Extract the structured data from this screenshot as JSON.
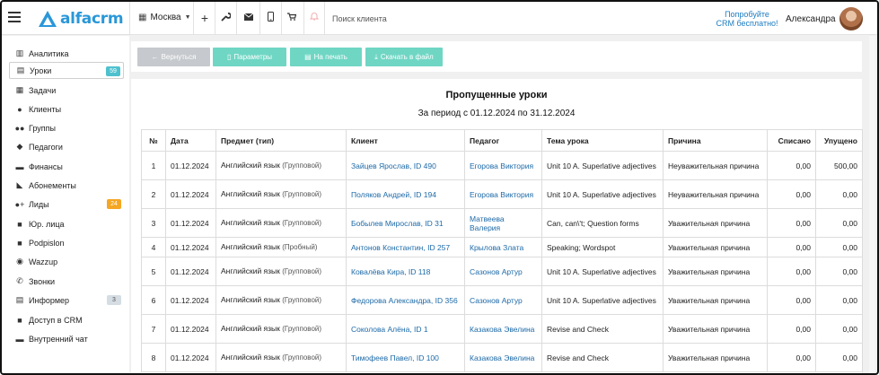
{
  "header": {
    "logo_text": "alfacrm",
    "branch": "Москва",
    "search_placeholder": "Поиск клиента",
    "promo_line1": "Попробуйте",
    "promo_line2": "CRM бесплатно!",
    "user_name": "Александра"
  },
  "sidebar": {
    "items": [
      {
        "label": "Аналитика",
        "icon": "chart-icon",
        "glyph": "▥"
      },
      {
        "label": "Уроки",
        "icon": "calendar-icon",
        "glyph": "▤",
        "badge": "59",
        "badge_color": "#4fc1ce",
        "active": true
      },
      {
        "label": "Задачи",
        "icon": "clipboard-icon",
        "glyph": "▦"
      },
      {
        "label": "Клиенты",
        "icon": "user-icon",
        "glyph": "●"
      },
      {
        "label": "Группы",
        "icon": "users-icon",
        "glyph": "●●"
      },
      {
        "label": "Педагоги",
        "icon": "graduation-cap-icon",
        "glyph": "◆"
      },
      {
        "label": "Финансы",
        "icon": "money-icon",
        "glyph": "▬"
      },
      {
        "label": "Абонементы",
        "icon": "tag-icon",
        "glyph": "◣"
      },
      {
        "label": "Лиды",
        "icon": "user-plus-icon",
        "glyph": "●+",
        "badge": "24",
        "badge_color": "#f5a623"
      },
      {
        "label": "Юр. лица",
        "icon": "truck-icon",
        "glyph": "■"
      },
      {
        "label": "Podpislon",
        "icon": "podpislon-icon",
        "glyph": "■"
      },
      {
        "label": "Wazzup",
        "icon": "whatsapp-icon",
        "glyph": "◉"
      },
      {
        "label": "Звонки",
        "icon": "phone-icon",
        "glyph": "✆"
      },
      {
        "label": "Информер",
        "icon": "newspaper-icon",
        "glyph": "▤",
        "badge": "3",
        "badge_color": "#d5dde3",
        "badge_text_color": "#555"
      },
      {
        "label": "Доступ в CRM",
        "icon": "lock-icon",
        "glyph": "■"
      },
      {
        "label": "Внутренний чат",
        "icon": "chat-icon",
        "glyph": "▬"
      }
    ]
  },
  "toolbar": {
    "back_label": "Вернуться",
    "params_label": "Параметры",
    "print_label": "На печать",
    "download_label": "Скачать в файл",
    "back_color": "#c6c9cd",
    "action_color": "#6fd6c4"
  },
  "report": {
    "title": "Пропущенные уроки",
    "subtitle": "За период с 01.12.2024 по 31.12.2024",
    "columns": [
      "№",
      "Дата",
      "Предмет (тип)",
      "Клиент",
      "Педагог",
      "Тема урока",
      "Причина",
      "Списано",
      "Упущено"
    ],
    "rows": [
      {
        "n": "1",
        "date": "01.12.2024",
        "subject": "Английский язык",
        "type": "(Групповой)",
        "client": "Зайцев Ярослав, ID 490",
        "teacher": "Егорова Виктория",
        "topic": "Unit 10 A. Superlative adjectives",
        "reason": "Неуважительная причина",
        "charged": "0,00",
        "missed": "500,00"
      },
      {
        "n": "2",
        "date": "01.12.2024",
        "subject": "Английский язык",
        "type": "(Групповой)",
        "client": "Поляков Андрей, ID 194",
        "teacher": "Егорова Виктория",
        "topic": "Unit 10 A. Superlative adjectives",
        "reason": "Неуважительная причина",
        "charged": "0,00",
        "missed": "0,00"
      },
      {
        "n": "3",
        "date": "01.12.2024",
        "subject": "Английский язык",
        "type": "(Групповой)",
        "client": "Бобылев Мирослав, ID 31",
        "teacher": "Матвеева Валерия",
        "topic": "Can, can\\'t; Question forms",
        "reason": "Уважительная причина",
        "charged": "0,00",
        "missed": "0,00"
      },
      {
        "n": "4",
        "date": "01.12.2024",
        "subject": "Английский язык",
        "type": "(Пробный)",
        "client": "Антонов Константин, ID 257",
        "teacher": "Крылова Злата",
        "topic": "Speaking; Wordspot",
        "reason": "Уважительная причина",
        "charged": "0,00",
        "missed": "0,00"
      },
      {
        "n": "5",
        "date": "01.12.2024",
        "subject": "Английский язык",
        "type": "(Групповой)",
        "client": "Ковалёва Кира, ID 118",
        "teacher": "Сазонов Артур",
        "topic": "Unit 10 A. Superlative adjectives",
        "reason": "Уважительная причина",
        "charged": "0,00",
        "missed": "0,00"
      },
      {
        "n": "6",
        "date": "01.12.2024",
        "subject": "Английский язык",
        "type": "(Групповой)",
        "client": "Федорова Александра, ID 356",
        "teacher": "Сазонов Артур",
        "topic": "Unit 10 A. Superlative adjectives",
        "reason": "Уважительная причина",
        "charged": "0,00",
        "missed": "0,00"
      },
      {
        "n": "7",
        "date": "01.12.2024",
        "subject": "Английский язык",
        "type": "(Групповой)",
        "client": "Соколова Алёна, ID 1",
        "teacher": "Казакова Эвелина",
        "topic": "Revise and Check",
        "reason": "Уважительная причина",
        "charged": "0,00",
        "missed": "0,00"
      },
      {
        "n": "8",
        "date": "01.12.2024",
        "subject": "Английский язык",
        "type": "(Групповой)",
        "client": "Тимофеев Павел, ID 100",
        "teacher": "Казакова Эвелина",
        "topic": "Revise and Check",
        "reason": "Уважительная причина",
        "charged": "0,00",
        "missed": "0,00"
      }
    ]
  }
}
